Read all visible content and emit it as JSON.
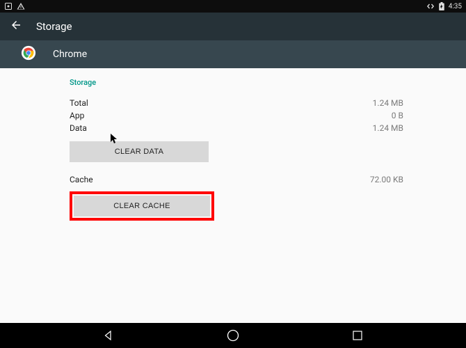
{
  "statusbar": {
    "time": "4:35"
  },
  "actionbar": {
    "title": "Storage"
  },
  "appheader": {
    "title": "Chrome"
  },
  "content": {
    "section_label": "Storage",
    "rows": {
      "total": {
        "label": "Total",
        "value": "1.24 MB"
      },
      "app": {
        "label": "App",
        "value": "0 B"
      },
      "data": {
        "label": "Data",
        "value": "1.24 MB"
      },
      "cache": {
        "label": "Cache",
        "value": "72.00 KB"
      }
    },
    "buttons": {
      "clear_data": "CLEAR DATA",
      "clear_cache": "CLEAR CACHE"
    }
  }
}
